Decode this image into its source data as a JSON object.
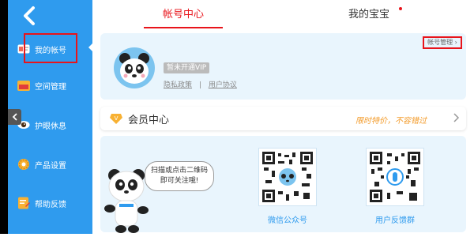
{
  "sidebar": {
    "items": [
      {
        "label": "我的帐号",
        "icon": "id-card-icon"
      },
      {
        "label": "空间管理",
        "icon": "folder-icon"
      },
      {
        "label": "护眼休息",
        "icon": "eye-icon"
      },
      {
        "label": "产品设置",
        "icon": "gear-icon"
      },
      {
        "label": "帮助反馈",
        "icon": "feedback-icon"
      }
    ]
  },
  "tabs": {
    "account_center": "帐号中心",
    "my_baby": "我的宝宝"
  },
  "profile": {
    "vip_status": "暂未开通VIP",
    "privacy_policy": "隐私政策",
    "separator": "|",
    "user_agreement": "用户协议",
    "account_management": "帐号管理 ›"
  },
  "member": {
    "title": "会员中心",
    "promo": "限时特价，不容错过"
  },
  "qr": {
    "bubble_line1": "扫描或点击二维码",
    "bubble_line2": "即可关注哦!",
    "wechat_label": "微信公众号",
    "feedback_group_label": "用户反馈群"
  },
  "colors": {
    "sidebar": "#2f9bee",
    "accent_red": "#e8141b",
    "promo_orange": "#f39b2a",
    "card_bg": "#e9f5fd"
  }
}
